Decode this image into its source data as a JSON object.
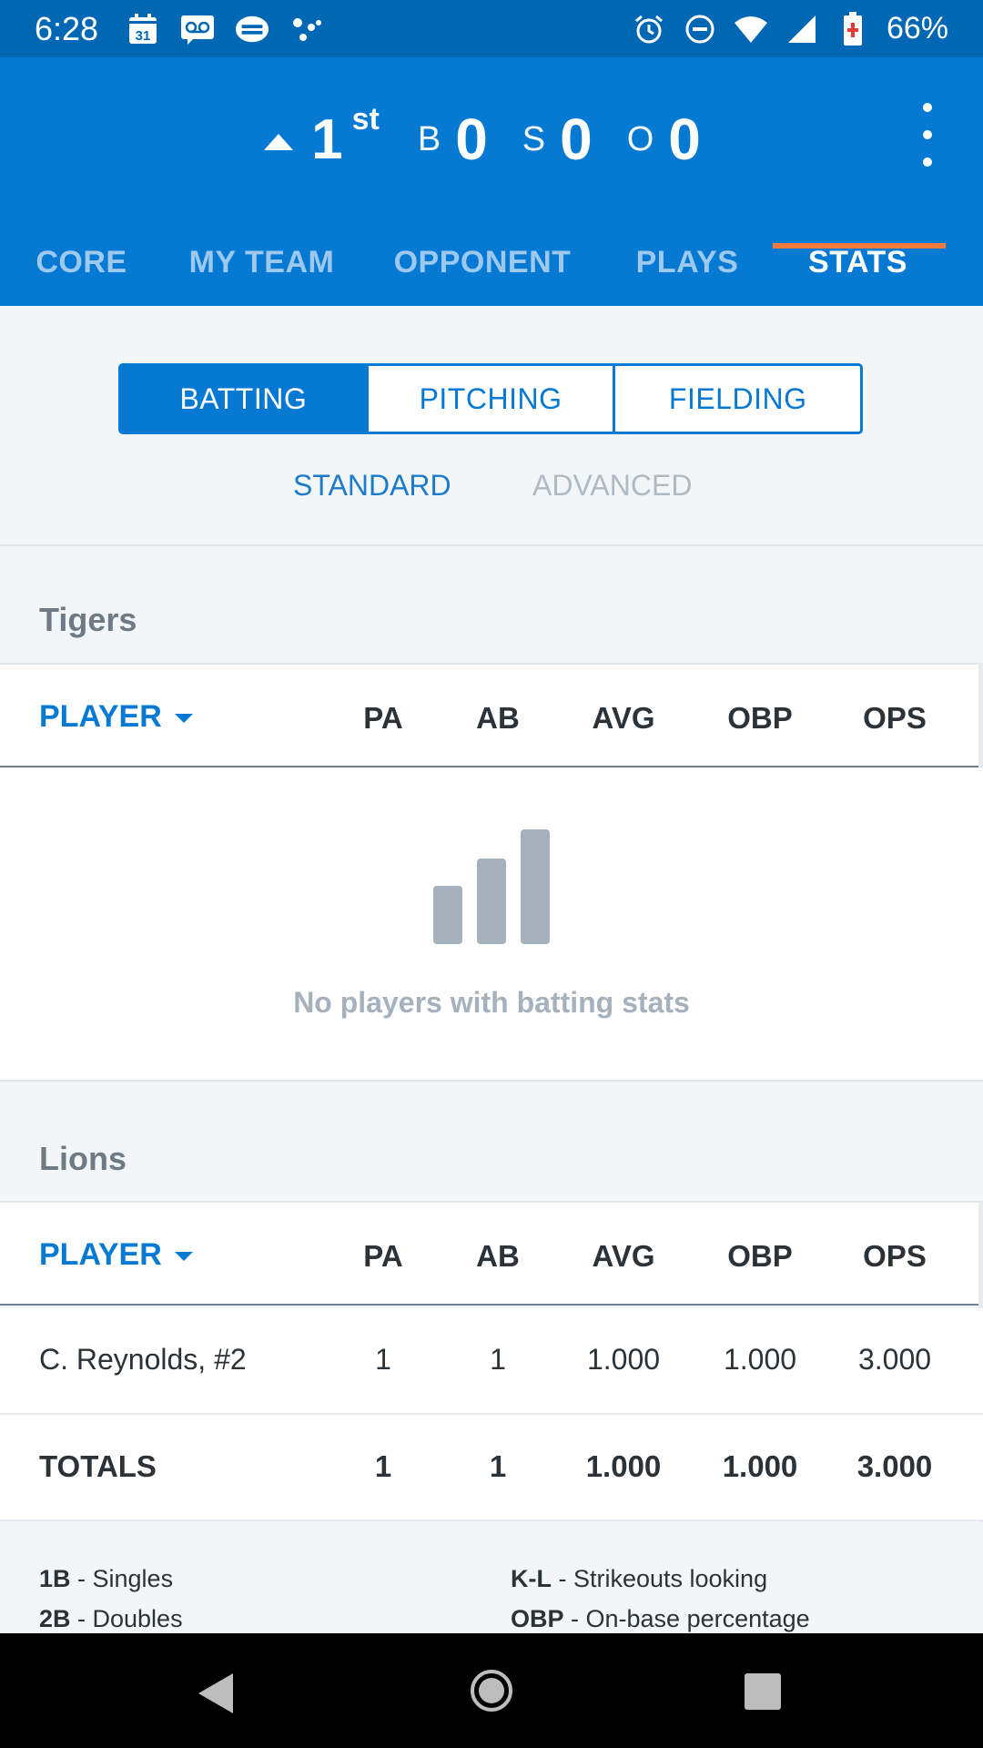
{
  "status_bar": {
    "time": "6:28",
    "battery": "66%",
    "left_icons": [
      "calendar-icon",
      "voicemail-icon",
      "game-controller-icon",
      "dots-icon"
    ],
    "right_icons": [
      "alarm-icon",
      "do-not-disturb-icon",
      "wifi-icon",
      "signal-icon",
      "battery-icon"
    ],
    "calendar_day": "31"
  },
  "scoreboard": {
    "inning": "1",
    "inning_suffix": "st",
    "balls_label": "B",
    "balls": "0",
    "strikes_label": "S",
    "strikes": "0",
    "outs_label": "O",
    "outs": "0"
  },
  "tabs": [
    "CORE",
    "MY TEAM",
    "OPPONENT",
    "PLAYS",
    "STATS"
  ],
  "active_tab": "STATS",
  "segments": [
    "BATTING",
    "PITCHING",
    "FIELDING"
  ],
  "active_segment": "BATTING",
  "subtabs": {
    "standard": "STANDARD",
    "advanced": "ADVANCED"
  },
  "columns": [
    "PA",
    "AB",
    "AVG",
    "OBP",
    "OPS"
  ],
  "player_header": "PLAYER",
  "teams": {
    "tigers": {
      "name": "Tigers",
      "empty_message": "No players with batting stats"
    },
    "lions": {
      "name": "Lions",
      "rows": [
        {
          "player": "C. Reynolds, #2",
          "pa": "1",
          "ab": "1",
          "avg": "1.000",
          "obp": "1.000",
          "ops": "3.000"
        }
      ],
      "totals": {
        "label": "TOTALS",
        "pa": "1",
        "ab": "1",
        "avg": "1.000",
        "obp": "1.000",
        "ops": "3.000"
      }
    }
  },
  "legend": {
    "left": [
      {
        "abbr": "1B",
        "desc": " - Singles"
      },
      {
        "abbr": "2B",
        "desc": " - Doubles"
      }
    ],
    "right": [
      {
        "abbr": "K-L",
        "desc": " - Strikeouts looking"
      },
      {
        "abbr": "OBP",
        "desc": " - On-base percentage"
      }
    ]
  },
  "colors": {
    "primary": "#0679d3",
    "status_bar": "#0067b5",
    "tab_indicator": "#f47b3b",
    "muted_icon": "#a5b1bc"
  }
}
